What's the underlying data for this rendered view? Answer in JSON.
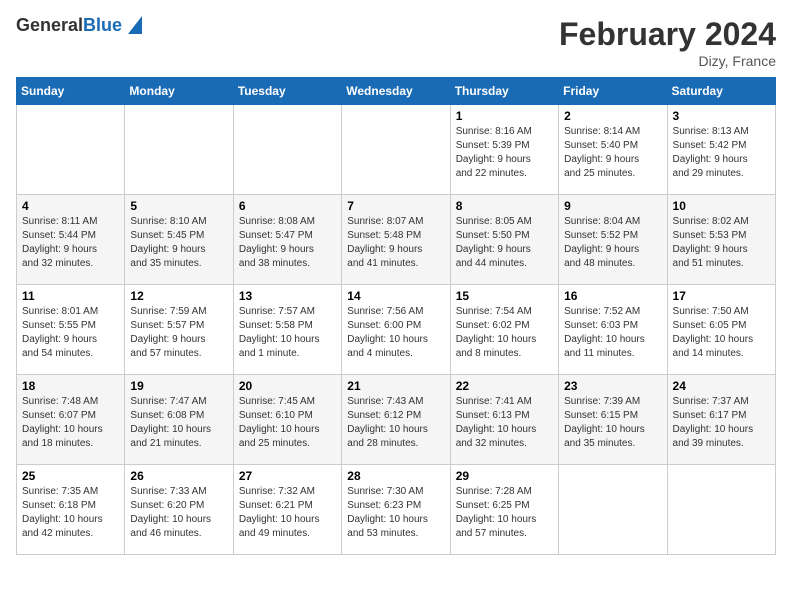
{
  "header": {
    "logo_general": "General",
    "logo_blue": "Blue",
    "title": "February 2024",
    "location": "Dizy, France"
  },
  "calendar": {
    "days_of_week": [
      "Sunday",
      "Monday",
      "Tuesday",
      "Wednesday",
      "Thursday",
      "Friday",
      "Saturday"
    ],
    "weeks": [
      [
        {
          "day": "",
          "content": ""
        },
        {
          "day": "",
          "content": ""
        },
        {
          "day": "",
          "content": ""
        },
        {
          "day": "",
          "content": ""
        },
        {
          "day": "1",
          "content": "Sunrise: 8:16 AM\nSunset: 5:39 PM\nDaylight: 9 hours\nand 22 minutes."
        },
        {
          "day": "2",
          "content": "Sunrise: 8:14 AM\nSunset: 5:40 PM\nDaylight: 9 hours\nand 25 minutes."
        },
        {
          "day": "3",
          "content": "Sunrise: 8:13 AM\nSunset: 5:42 PM\nDaylight: 9 hours\nand 29 minutes."
        }
      ],
      [
        {
          "day": "4",
          "content": "Sunrise: 8:11 AM\nSunset: 5:44 PM\nDaylight: 9 hours\nand 32 minutes."
        },
        {
          "day": "5",
          "content": "Sunrise: 8:10 AM\nSunset: 5:45 PM\nDaylight: 9 hours\nand 35 minutes."
        },
        {
          "day": "6",
          "content": "Sunrise: 8:08 AM\nSunset: 5:47 PM\nDaylight: 9 hours\nand 38 minutes."
        },
        {
          "day": "7",
          "content": "Sunrise: 8:07 AM\nSunset: 5:48 PM\nDaylight: 9 hours\nand 41 minutes."
        },
        {
          "day": "8",
          "content": "Sunrise: 8:05 AM\nSunset: 5:50 PM\nDaylight: 9 hours\nand 44 minutes."
        },
        {
          "day": "9",
          "content": "Sunrise: 8:04 AM\nSunset: 5:52 PM\nDaylight: 9 hours\nand 48 minutes."
        },
        {
          "day": "10",
          "content": "Sunrise: 8:02 AM\nSunset: 5:53 PM\nDaylight: 9 hours\nand 51 minutes."
        }
      ],
      [
        {
          "day": "11",
          "content": "Sunrise: 8:01 AM\nSunset: 5:55 PM\nDaylight: 9 hours\nand 54 minutes."
        },
        {
          "day": "12",
          "content": "Sunrise: 7:59 AM\nSunset: 5:57 PM\nDaylight: 9 hours\nand 57 minutes."
        },
        {
          "day": "13",
          "content": "Sunrise: 7:57 AM\nSunset: 5:58 PM\nDaylight: 10 hours\nand 1 minute."
        },
        {
          "day": "14",
          "content": "Sunrise: 7:56 AM\nSunset: 6:00 PM\nDaylight: 10 hours\nand 4 minutes."
        },
        {
          "day": "15",
          "content": "Sunrise: 7:54 AM\nSunset: 6:02 PM\nDaylight: 10 hours\nand 8 minutes."
        },
        {
          "day": "16",
          "content": "Sunrise: 7:52 AM\nSunset: 6:03 PM\nDaylight: 10 hours\nand 11 minutes."
        },
        {
          "day": "17",
          "content": "Sunrise: 7:50 AM\nSunset: 6:05 PM\nDaylight: 10 hours\nand 14 minutes."
        }
      ],
      [
        {
          "day": "18",
          "content": "Sunrise: 7:48 AM\nSunset: 6:07 PM\nDaylight: 10 hours\nand 18 minutes."
        },
        {
          "day": "19",
          "content": "Sunrise: 7:47 AM\nSunset: 6:08 PM\nDaylight: 10 hours\nand 21 minutes."
        },
        {
          "day": "20",
          "content": "Sunrise: 7:45 AM\nSunset: 6:10 PM\nDaylight: 10 hours\nand 25 minutes."
        },
        {
          "day": "21",
          "content": "Sunrise: 7:43 AM\nSunset: 6:12 PM\nDaylight: 10 hours\nand 28 minutes."
        },
        {
          "day": "22",
          "content": "Sunrise: 7:41 AM\nSunset: 6:13 PM\nDaylight: 10 hours\nand 32 minutes."
        },
        {
          "day": "23",
          "content": "Sunrise: 7:39 AM\nSunset: 6:15 PM\nDaylight: 10 hours\nand 35 minutes."
        },
        {
          "day": "24",
          "content": "Sunrise: 7:37 AM\nSunset: 6:17 PM\nDaylight: 10 hours\nand 39 minutes."
        }
      ],
      [
        {
          "day": "25",
          "content": "Sunrise: 7:35 AM\nSunset: 6:18 PM\nDaylight: 10 hours\nand 42 minutes."
        },
        {
          "day": "26",
          "content": "Sunrise: 7:33 AM\nSunset: 6:20 PM\nDaylight: 10 hours\nand 46 minutes."
        },
        {
          "day": "27",
          "content": "Sunrise: 7:32 AM\nSunset: 6:21 PM\nDaylight: 10 hours\nand 49 minutes."
        },
        {
          "day": "28",
          "content": "Sunrise: 7:30 AM\nSunset: 6:23 PM\nDaylight: 10 hours\nand 53 minutes."
        },
        {
          "day": "29",
          "content": "Sunrise: 7:28 AM\nSunset: 6:25 PM\nDaylight: 10 hours\nand 57 minutes."
        },
        {
          "day": "",
          "content": ""
        },
        {
          "day": "",
          "content": ""
        }
      ]
    ]
  }
}
